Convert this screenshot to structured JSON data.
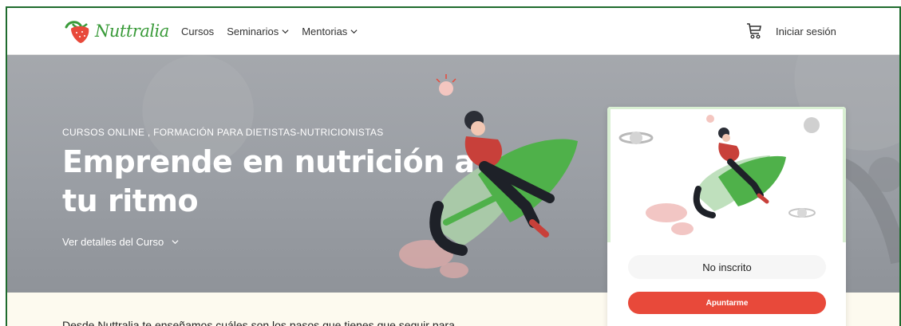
{
  "brand": {
    "name": "Nuttralia",
    "green": "#3a9b3a",
    "red": "#e8493a"
  },
  "nav": {
    "items": [
      {
        "label": "Cursos",
        "has_dropdown": false
      },
      {
        "label": "Seminarios",
        "has_dropdown": true
      },
      {
        "label": "Mentorias",
        "has_dropdown": true
      }
    ],
    "cart_icon": "cart-icon",
    "login_label": "Iniciar sesión"
  },
  "hero": {
    "eyebrow": "CURSOS ONLINE ,  FORMACIÓN PARA DIETISTAS-NUTRICIONISTAS",
    "title": "Emprende en nutrición a tu ritmo",
    "details_label": "Ver detalles del Curso",
    "details_icon": "chevron-down-icon"
  },
  "card": {
    "status_label": "No inscrito",
    "enroll_label": "Apuntarme"
  },
  "intro": {
    "text": "Desde Nuttralia te enseñamos cuáles son los pasos que tienes que seguir para"
  }
}
